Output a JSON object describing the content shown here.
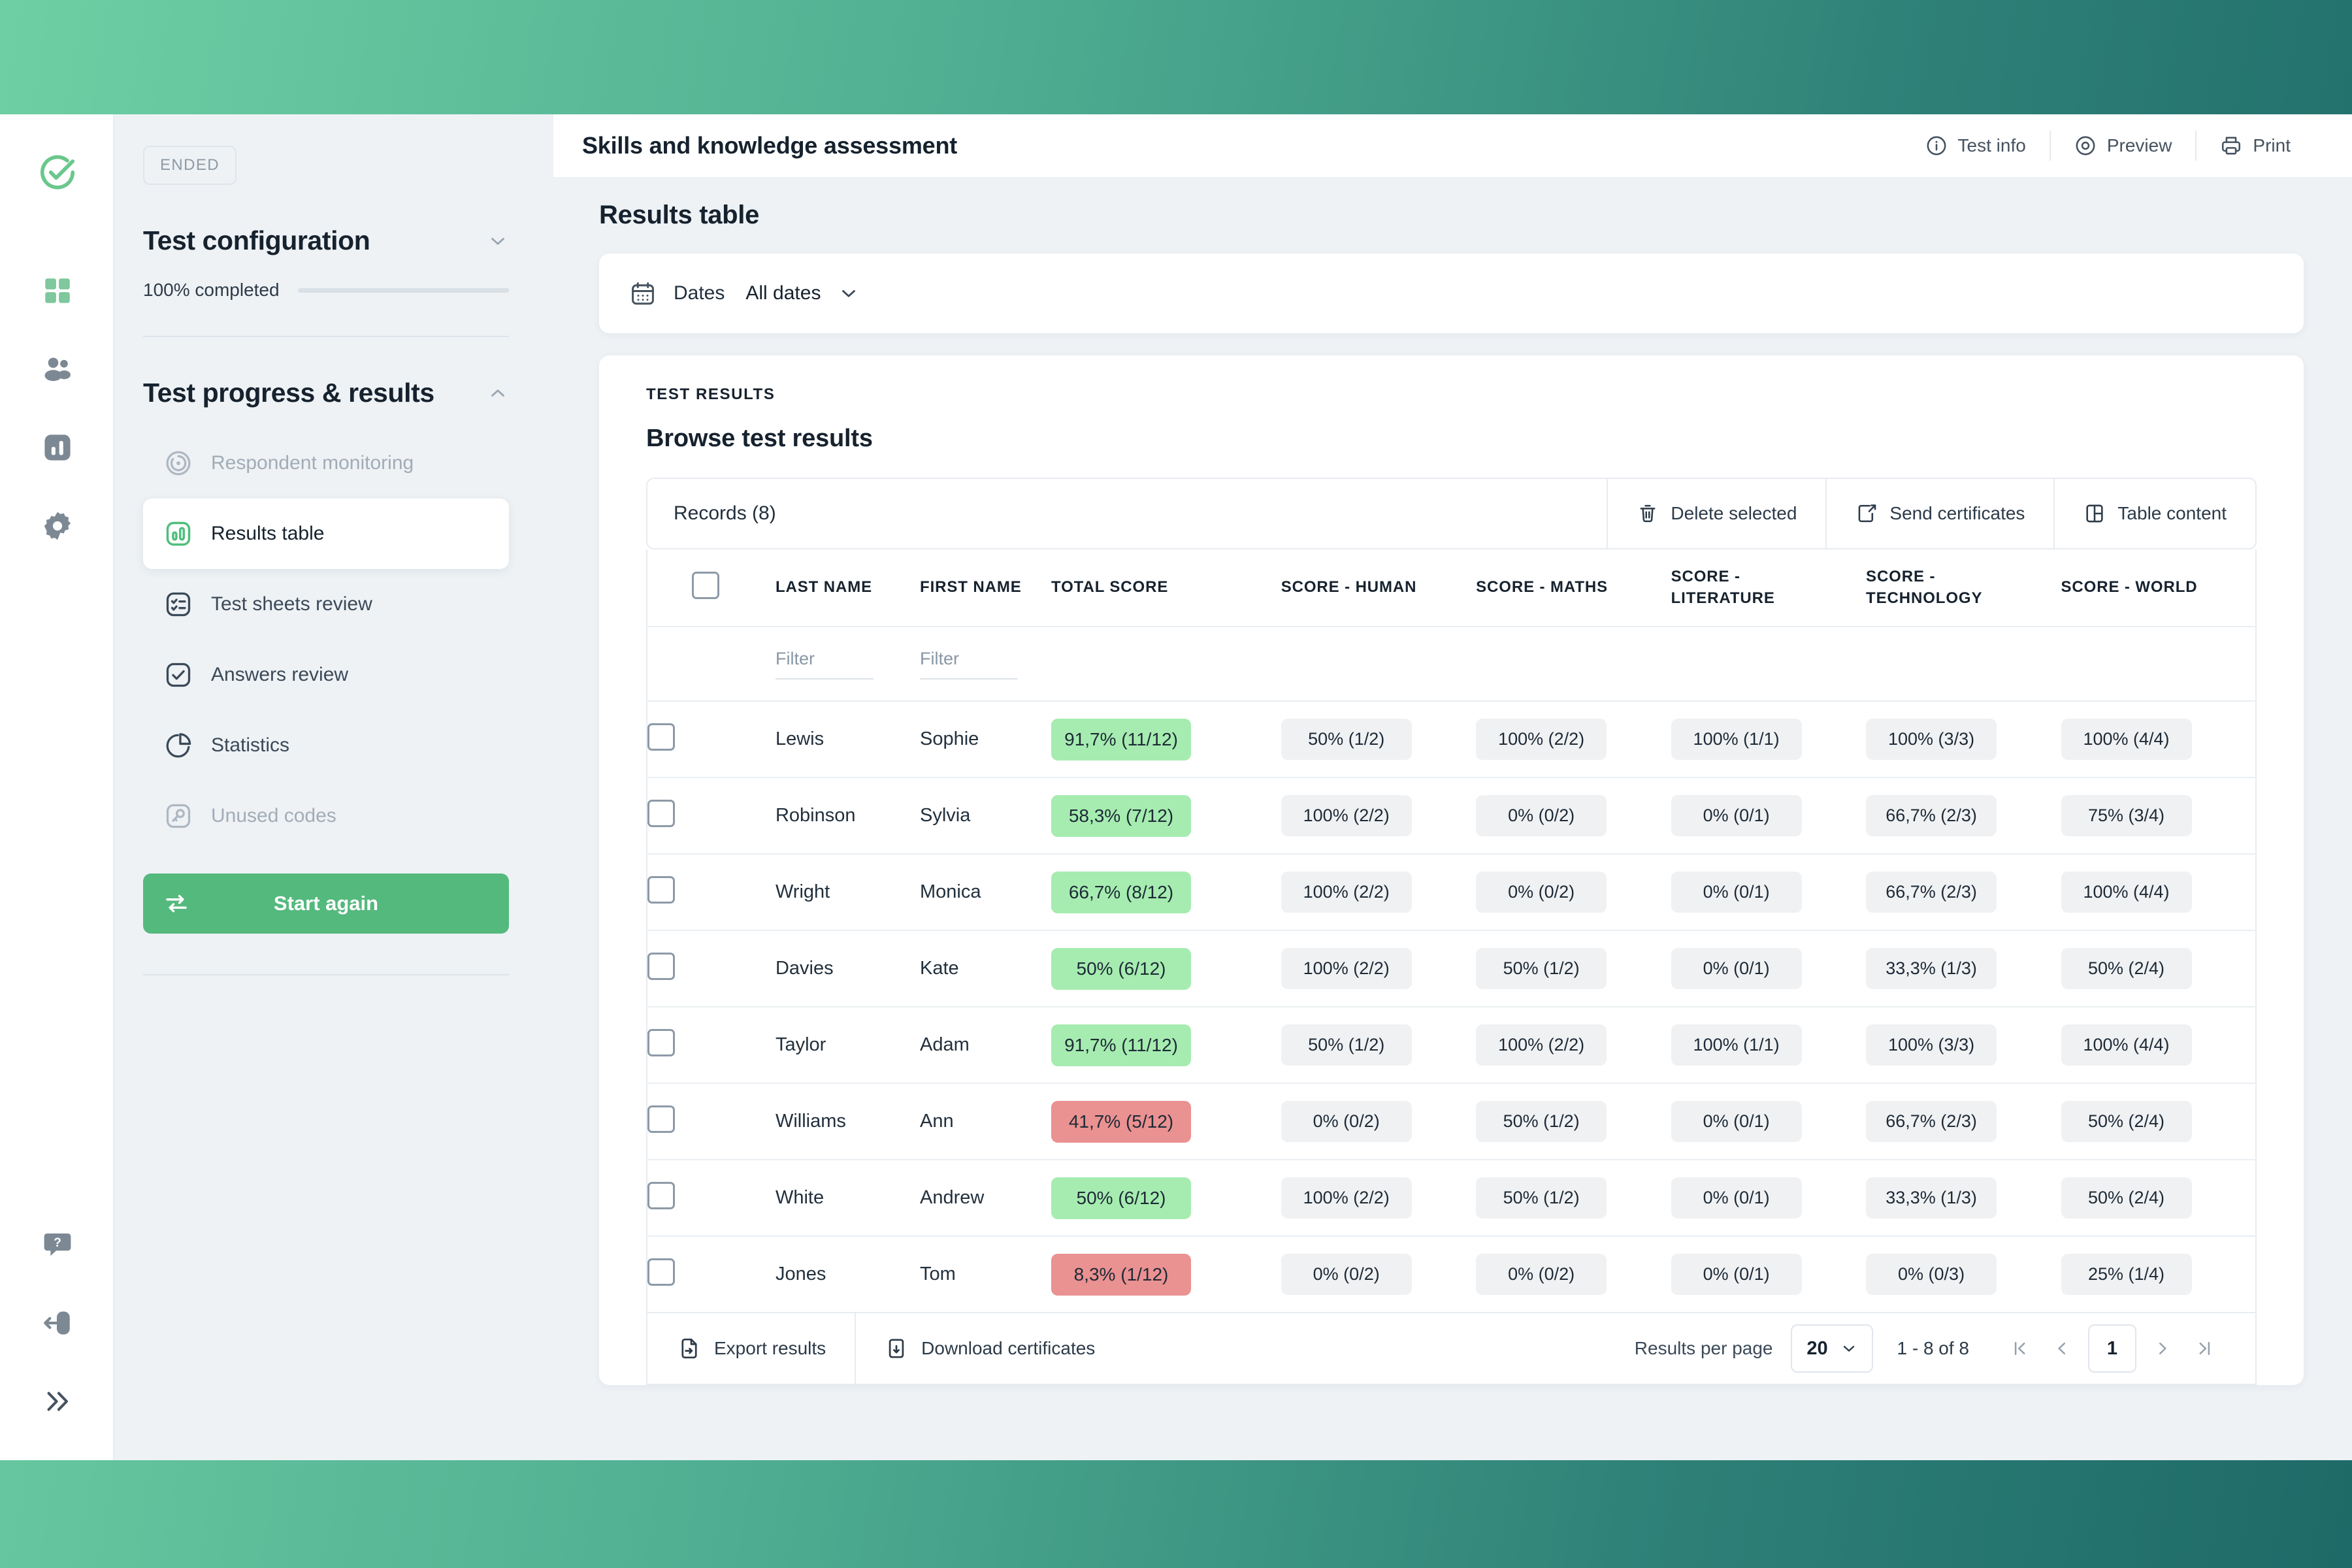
{
  "topbar": {
    "title": "Skills and knowledge assessment",
    "actions": [
      {
        "label": "Test info",
        "icon": "info-circle-icon"
      },
      {
        "label": "Preview",
        "icon": "eye-circle-icon"
      },
      {
        "label": "Print",
        "icon": "printer-icon"
      }
    ]
  },
  "left_panel": {
    "status_badge": "ENDED",
    "config_section": {
      "title": "Test configuration",
      "progress_label": "100% completed",
      "progress_percent": 100
    },
    "results_section": {
      "title": "Test progress & results",
      "items": [
        {
          "label": "Respondent monitoring",
          "icon": "monitoring-icon",
          "state": "disabled"
        },
        {
          "label": "Results table",
          "icon": "bar-chart-icon",
          "state": "active"
        },
        {
          "label": "Test sheets review",
          "icon": "checklist-icon",
          "state": "normal"
        },
        {
          "label": "Answers review",
          "icon": "check-square-icon",
          "state": "normal"
        },
        {
          "label": "Statistics",
          "icon": "pie-chart-icon",
          "state": "normal"
        },
        {
          "label": "Unused codes",
          "icon": "key-icon",
          "state": "disabled"
        }
      ],
      "start_again_label": "Start again"
    }
  },
  "rail": {
    "items": [
      {
        "icon": "logo-check-icon"
      },
      {
        "icon": "grid-dashboard-icon"
      },
      {
        "icon": "users-icon"
      },
      {
        "icon": "chart-icon"
      },
      {
        "icon": "gear-icon"
      },
      {
        "icon": "help-bubble-icon"
      },
      {
        "icon": "logout-icon"
      },
      {
        "icon": "expand-chevrons-icon"
      }
    ]
  },
  "main": {
    "page_title": "Results table",
    "dates_filter": {
      "icon": "calendar-icon",
      "label": "Dates",
      "value": "All dates"
    },
    "eyebrow": "TEST RESULTS",
    "browse_title": "Browse test results",
    "records_bar": {
      "records_label": "Records (8)",
      "actions": [
        {
          "label": "Delete selected",
          "icon": "trash-icon"
        },
        {
          "label": "Send certificates",
          "icon": "send-certificate-icon"
        },
        {
          "label": "Table content",
          "icon": "table-content-icon"
        }
      ]
    },
    "table": {
      "columns": [
        "LAST NAME",
        "FIRST NAME",
        "TOTAL SCORE",
        "SCORE - HUMAN",
        "SCORE - MATHS",
        "SCORE - LITERATURE",
        "SCORE - TECHNOLOGY",
        "SCORE - WORLD"
      ],
      "filter_placeholder": "Filter",
      "rows": [
        {
          "last_name": "Lewis",
          "first_name": "Sophie",
          "total": "91,7% (11/12)",
          "total_status": "good",
          "human": "50% (1/2)",
          "maths": "100% (2/2)",
          "literature": "100% (1/1)",
          "technology": "100% (3/3)",
          "world": "100% (4/4)"
        },
        {
          "last_name": "Robinson",
          "first_name": "Sylvia",
          "total": "58,3% (7/12)",
          "total_status": "good",
          "human": "100% (2/2)",
          "maths": "0% (0/2)",
          "literature": "0% (0/1)",
          "technology": "66,7% (2/3)",
          "world": "75% (3/4)"
        },
        {
          "last_name": "Wright",
          "first_name": "Monica",
          "total": "66,7% (8/12)",
          "total_status": "good",
          "human": "100% (2/2)",
          "maths": "0% (0/2)",
          "literature": "0% (0/1)",
          "technology": "66,7% (2/3)",
          "world": "100% (4/4)"
        },
        {
          "last_name": "Davies",
          "first_name": "Kate",
          "total": "50% (6/12)",
          "total_status": "good",
          "human": "100% (2/2)",
          "maths": "50% (1/2)",
          "literature": "0% (0/1)",
          "technology": "33,3% (1/3)",
          "world": "50% (2/4)"
        },
        {
          "last_name": "Taylor",
          "first_name": "Adam",
          "total": "91,7% (11/12)",
          "total_status": "good",
          "human": "50% (1/2)",
          "maths": "100% (2/2)",
          "literature": "100% (1/1)",
          "technology": "100% (3/3)",
          "world": "100% (4/4)"
        },
        {
          "last_name": "Williams",
          "first_name": "Ann",
          "total": "41,7% (5/12)",
          "total_status": "bad",
          "human": "0% (0/2)",
          "maths": "50% (1/2)",
          "literature": "0% (0/1)",
          "technology": "66,7% (2/3)",
          "world": "50% (2/4)"
        },
        {
          "last_name": "White",
          "first_name": "Andrew",
          "total": "50% (6/12)",
          "total_status": "good",
          "human": "100% (2/2)",
          "maths": "50% (1/2)",
          "literature": "0% (0/1)",
          "technology": "33,3% (1/3)",
          "world": "50% (2/4)"
        },
        {
          "last_name": "Jones",
          "first_name": "Tom",
          "total": "8,3% (1/12)",
          "total_status": "bad",
          "human": "0% (0/2)",
          "maths": "0% (0/2)",
          "literature": "0% (0/1)",
          "technology": "0% (0/3)",
          "world": "25% (1/4)"
        }
      ]
    },
    "table_footer": {
      "export_label": "Export results",
      "download_label": "Download certificates",
      "per_page_label": "Results per page",
      "per_page_value": "20",
      "range_label": "1 - 8 of 8",
      "current_page": "1"
    }
  },
  "colors": {
    "accent_green": "#54b97d",
    "pill_good": "#a6ecb0",
    "pill_bad": "#ea9191",
    "pill_neutral": "#f0f1f3",
    "panel_bg": "#eef2f5"
  }
}
